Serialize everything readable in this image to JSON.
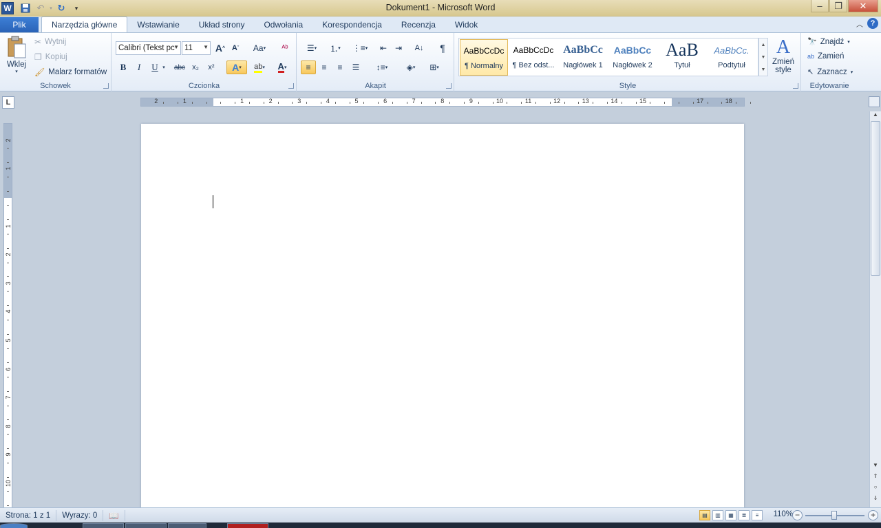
{
  "window": {
    "title": "Dokument1  -  Microsoft Word"
  },
  "qat": {
    "logo_letter": "W",
    "save_icon": "save-icon",
    "undo_icon": "undo-icon",
    "redo_icon": "redo-icon"
  },
  "tabs": {
    "file": "Plik",
    "items": [
      "Narzędzia główne",
      "Wstawianie",
      "Układ strony",
      "Odwołania",
      "Korespondencja",
      "Recenzja",
      "Widok"
    ],
    "help": "?"
  },
  "clipboard": {
    "paste": "Wklej",
    "cut": "Wytnij",
    "copy": "Kopiuj",
    "format_painter": "Malarz formatów",
    "label": "Schowek"
  },
  "font": {
    "name": "Calibri (Tekst pc",
    "size": "11",
    "label": "Czcionka",
    "grow": "A",
    "shrink": "A",
    "case": "Aa",
    "bold": "B",
    "italic": "I",
    "underline": "U",
    "strike": "abc",
    "sub": "x₂",
    "sup": "x²",
    "color": "A"
  },
  "paragraph": {
    "label": "Akapit",
    "pilcrow": "¶"
  },
  "styles": {
    "label": "Style",
    "items": [
      {
        "preview": "AaBbCcDc",
        "name": "¶ Normalny"
      },
      {
        "preview": "AaBbCcDc",
        "name": "¶ Bez odst..."
      },
      {
        "preview": "AaBbCc",
        "name": "Nagłówek 1"
      },
      {
        "preview": "AaBbCc",
        "name": "Nagłówek 2"
      },
      {
        "preview": "AaB",
        "name": "Tytuł"
      },
      {
        "preview": "AaBbCc.",
        "name": "Podtytuł"
      }
    ],
    "change": "Zmień style",
    "change_line1": "Zmień",
    "change_line2": "style"
  },
  "editing": {
    "label": "Edytowanie",
    "find": "Znajdź",
    "replace": "Zamień",
    "select": "Zaznacz"
  },
  "ruler": {
    "tab_selector": "L",
    "h_left": [
      "2",
      "1"
    ],
    "h_right": [
      "1",
      "2",
      "3",
      "4",
      "5",
      "6",
      "7",
      "8",
      "9",
      "10",
      "11",
      "12",
      "13",
      "14",
      "15",
      "17",
      "18"
    ],
    "v_top": [
      "2",
      "1"
    ],
    "v_bottom": [
      "1",
      "2",
      "3",
      "4",
      "5",
      "6",
      "7",
      "8",
      "9",
      "10"
    ]
  },
  "status": {
    "page": "Strona: 1 z 1",
    "words": "Wyrazy: 0",
    "zoom": "110%"
  },
  "colors": {
    "accent": "#2b5797",
    "file_tab": "#2a63b7",
    "highlight": "#f8c85c"
  }
}
